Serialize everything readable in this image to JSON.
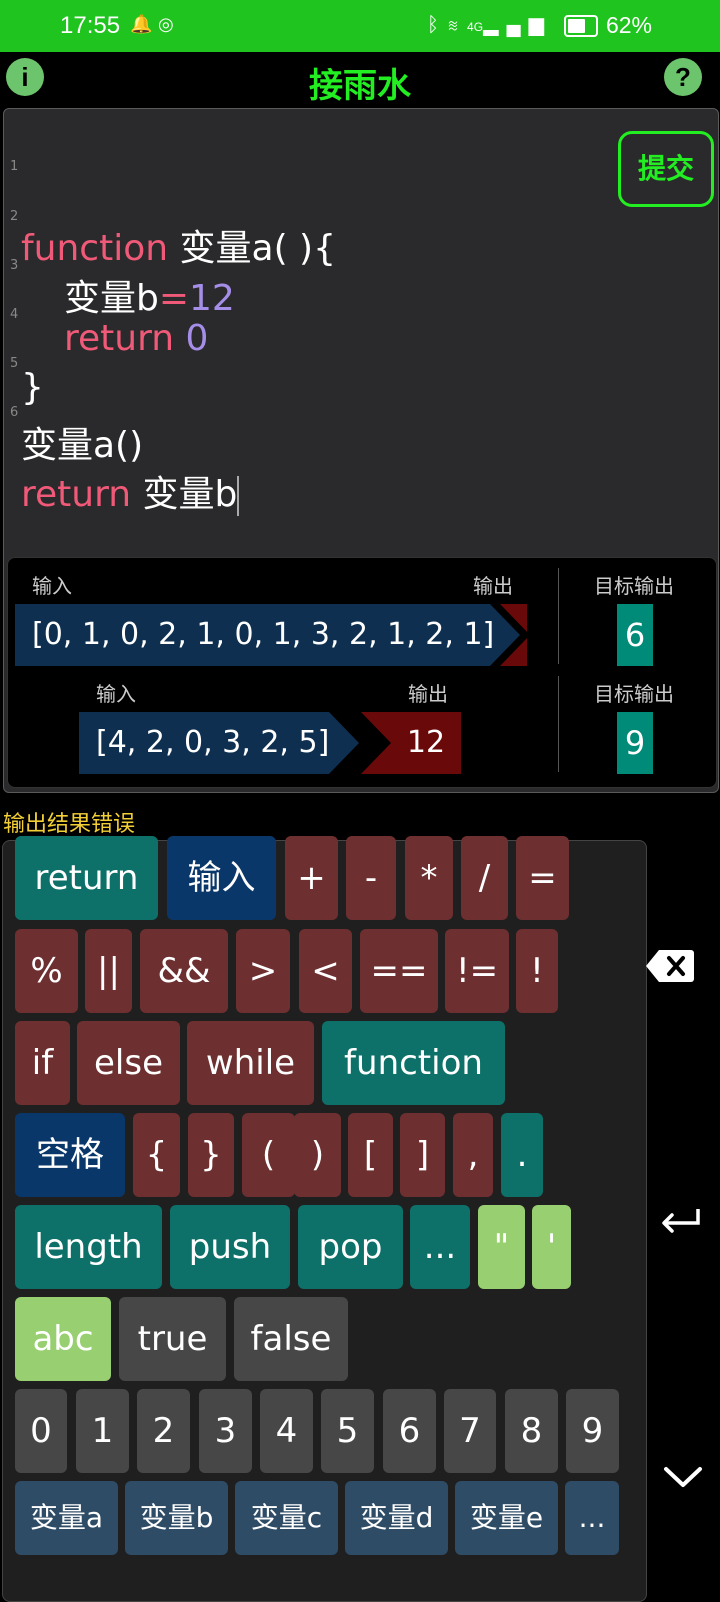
{
  "status": {
    "time": "17:55",
    "battery_pct": "62%",
    "net_label": "4G",
    "battery_level": 0.62
  },
  "header": {
    "title": "接雨水",
    "info_glyph": "i",
    "help_glyph": "?"
  },
  "editor": {
    "submit_label": "提交",
    "lines": [
      {
        "num": "1",
        "kw1": "function",
        "rest": " 变量a( ){"
      },
      {
        "num": "2",
        "indent": "  ",
        "var": "变量b",
        "eq": "=",
        "num_val": "12"
      },
      {
        "num": "3",
        "indent": "  ",
        "kw1": "return",
        "num_val": "0"
      },
      {
        "num": "4",
        "rest": "}"
      },
      {
        "num": "5",
        "rest": "变量a()"
      },
      {
        "num": "6",
        "kw1": "return",
        "rest": " 变量b"
      }
    ]
  },
  "tests": {
    "input_label": "输入",
    "output_label": "输出",
    "target_label": "目标输出",
    "cases": [
      {
        "input": "[0, 1, 0, 2, 1, 0, 1, 3, 2, 1, 2, 1]",
        "output": "",
        "target": "6"
      },
      {
        "input": "[4, 2, 0, 3, 2, 5]",
        "output": "12",
        "target": "9"
      }
    ]
  },
  "error_message": "输出结果错误",
  "keyboard": {
    "row1": [
      "return",
      "输入",
      "+",
      "-",
      "*",
      "/",
      "="
    ],
    "row2": [
      "%",
      "||",
      "&&",
      ">",
      "<",
      "==",
      "!=",
      "!"
    ],
    "row3": [
      "if",
      "else",
      "while",
      "function"
    ],
    "row4": [
      "空格",
      "{",
      "}",
      "(",
      ")",
      "[",
      "]",
      ",",
      "."
    ],
    "row5": [
      "length",
      "push",
      "pop",
      "...",
      "\"",
      "'"
    ],
    "row6": [
      "abc",
      "true",
      "false"
    ],
    "row7": [
      "0",
      "1",
      "2",
      "3",
      "4",
      "5",
      "6",
      "7",
      "8",
      "9"
    ],
    "row8": [
      "变量a",
      "变量b",
      "变量c",
      "变量d",
      "变量e",
      "..."
    ]
  },
  "side": {
    "backspace_icon": "backspace-icon",
    "enter_icon": "enter-icon",
    "collapse_icon": "chevron-down-icon"
  }
}
